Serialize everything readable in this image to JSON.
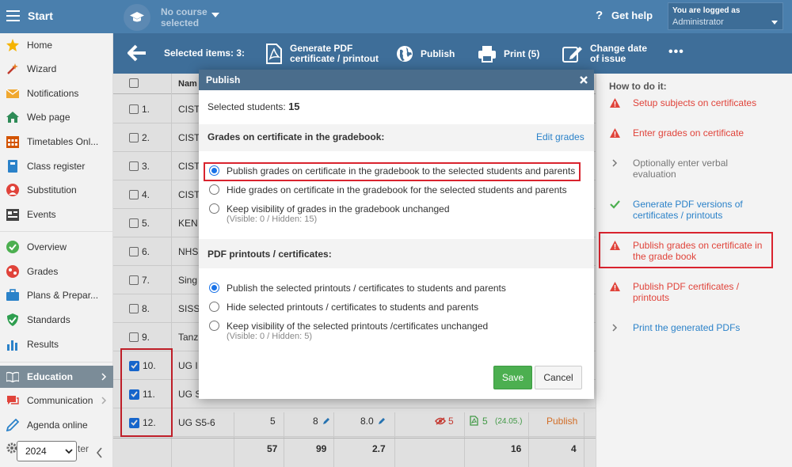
{
  "topbar": {
    "start_label": "Start",
    "course_label": "No course selected",
    "help_label": "Get help",
    "logged_label": "You are logged as",
    "user_label": "Administrator"
  },
  "sidebar": {
    "items": [
      {
        "label": "Home",
        "icon": "star-icon"
      },
      {
        "label": "Wizard",
        "icon": "wand-icon"
      },
      {
        "label": "Notifications",
        "icon": "envelope-icon"
      },
      {
        "label": "Web page",
        "icon": "house-icon"
      },
      {
        "label": "Timetables Onl...",
        "icon": "calendar-icon"
      },
      {
        "label": "Class register",
        "icon": "book-icon"
      },
      {
        "label": "Substitution",
        "icon": "person-icon"
      },
      {
        "label": "Events",
        "icon": "events-icon"
      },
      {
        "label": "Overview",
        "icon": "check-circle-icon"
      },
      {
        "label": "Grades",
        "icon": "grades-icon"
      },
      {
        "label": "Plans & Prepar...",
        "icon": "briefcase-icon"
      },
      {
        "label": "Standards",
        "icon": "shield-icon"
      },
      {
        "label": "Results",
        "icon": "bar-chart-icon"
      },
      {
        "label": "Education",
        "icon": "open-book-icon"
      },
      {
        "label": "Communication",
        "icon": "chat-icon"
      },
      {
        "label": "Agenda online",
        "icon": "pen-icon"
      }
    ],
    "year": "2024",
    "bottom_fragment": "ter"
  },
  "actionbar": {
    "selected_label": "Selected items: 3:",
    "generate_label_1": "Generate PDF",
    "generate_label_2": "certificate / printout",
    "publish_label": "Publish",
    "print_label": "Print (5)",
    "change_label_1": "Change date",
    "change_label_2": "of issue",
    "more_label": "•••"
  },
  "table": {
    "name_header": "Nam",
    "rows": [
      {
        "num": "1.",
        "name": "CIST",
        "checked": false
      },
      {
        "num": "2.",
        "name": "CIST",
        "checked": false
      },
      {
        "num": "3.",
        "name": "CIST",
        "checked": false
      },
      {
        "num": "4.",
        "name": "CIST",
        "checked": false
      },
      {
        "num": "5.",
        "name": "KEN",
        "checked": false
      },
      {
        "num": "6.",
        "name": "NHS",
        "checked": false
      },
      {
        "num": "7.",
        "name": "Sing",
        "checked": false
      },
      {
        "num": "8.",
        "name": "SISS",
        "checked": false
      },
      {
        "num": "9.",
        "name": "Tanz",
        "checked": false
      },
      {
        "num": "10.",
        "name": "UG I",
        "checked": true
      },
      {
        "num": "11.",
        "name": "UG S",
        "checked": true
      },
      {
        "num": "12.",
        "name": "UG S5-6",
        "checked": true
      }
    ],
    "row12": {
      "c1": "5",
      "c2": "8",
      "c3": "8.0",
      "c4": "5",
      "c5": "5",
      "c5_date": "(24.05.)",
      "c6": "Publish"
    },
    "totals": {
      "c1": "57",
      "c2": "99",
      "c3": "2.7",
      "c5": "16",
      "c6": "4"
    }
  },
  "modal": {
    "title": "Publish",
    "selected_label": "Selected students:",
    "selected_count": "15",
    "grades_heading": "Grades on certificate in the gradebook:",
    "edit_grades": "Edit grades",
    "grades_options": [
      {
        "label": "Publish grades on certificate in the gradebook to the selected students and parents",
        "checked": true
      },
      {
        "label": "Hide grades on certificate in the gradebook for the selected students and parents",
        "checked": false
      },
      {
        "label": "Keep visibility of grades in the gradebook unchanged",
        "sub": "(Visible: 0 / Hidden: 15)",
        "checked": false
      }
    ],
    "pdf_heading": "PDF printouts / certificates:",
    "pdf_options": [
      {
        "label": "Publish the selected printouts / certificates to students and parents",
        "checked": true
      },
      {
        "label": "Hide selected printouts / certificates to students and parents",
        "checked": false
      },
      {
        "label": "Keep visibility of the selected printouts /certificates unchanged",
        "sub": "(Visible: 0 / Hidden: 5)",
        "checked": false
      }
    ],
    "save_label": "Save",
    "cancel_label": "Cancel"
  },
  "howto": {
    "title": "How to do it:",
    "items": [
      {
        "label": "Setup subjects on certificates",
        "status": "warning"
      },
      {
        "label": "Enter grades on certificate",
        "status": "warning"
      },
      {
        "label": "Optionally enter verbal evaluation",
        "status": "optional"
      },
      {
        "label": "Generate PDF versions of certificates / printouts",
        "status": "done"
      },
      {
        "label": "Publish grades on certificate in the grade book",
        "status": "warning"
      },
      {
        "label": "Publish PDF certificates / printouts",
        "status": "warning"
      },
      {
        "label": "Print the generated PDFs",
        "status": "todo"
      }
    ]
  },
  "colors": {
    "topbar": "#4a7fad",
    "actionbar": "#3e6e99",
    "highlight": "#d9232e",
    "save": "#4caf50",
    "warning": "#e0433a",
    "link": "#2b82c9"
  }
}
